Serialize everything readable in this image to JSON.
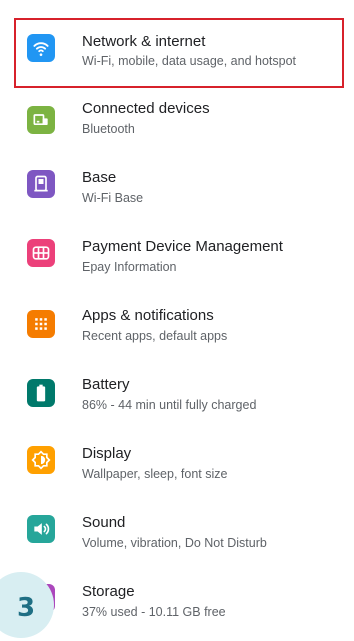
{
  "settings": {
    "items": [
      {
        "title": "Network & internet",
        "subtitle": "Wi-Fi, mobile, data usage, and hotspot",
        "icon": "wifi-icon",
        "color": "#2196f3"
      },
      {
        "title": "Connected devices",
        "subtitle": "Bluetooth",
        "icon": "connected-devices-icon",
        "color": "#7cb342"
      },
      {
        "title": "Base",
        "subtitle": "Wi-Fi Base",
        "icon": "base-device-icon",
        "color": "#7e57c2"
      },
      {
        "title": "Payment Device Management",
        "subtitle": "Epay Information",
        "icon": "payment-device-icon",
        "color": "#ec407a"
      },
      {
        "title": "Apps & notifications",
        "subtitle": "Recent apps, default apps",
        "icon": "apps-grid-icon",
        "color": "#f57c00"
      },
      {
        "title": "Battery",
        "subtitle": "86% - 44 min until fully charged",
        "icon": "battery-icon",
        "color": "#00796b"
      },
      {
        "title": "Display",
        "subtitle": "Wallpaper, sleep, font size",
        "icon": "display-brightness-icon",
        "color": "#ffa000"
      },
      {
        "title": "Sound",
        "subtitle": "Volume, vibration, Do Not Disturb",
        "icon": "sound-icon",
        "color": "#26a69a"
      },
      {
        "title": "Storage",
        "subtitle": "37% used - 10.11 GB free",
        "icon": "storage-icon",
        "color": "#ab47bc"
      }
    ]
  },
  "highlight": {
    "color": "#d7212b"
  },
  "step_badge": {
    "label": "3"
  }
}
